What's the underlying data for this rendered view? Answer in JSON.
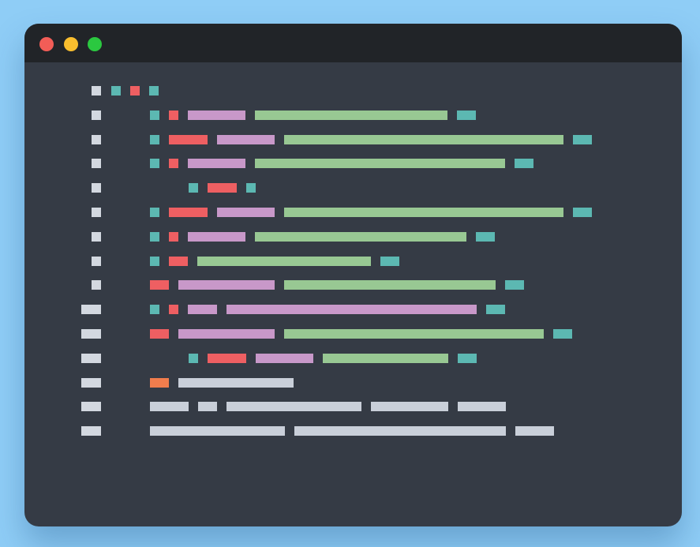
{
  "window": {
    "colors": {
      "background": "#8fcdf6",
      "window": "#353b45",
      "titlebar": "#212428"
    },
    "controls": [
      {
        "name": "close-button",
        "color": "#f25d57"
      },
      {
        "name": "minimize-button",
        "color": "#f9be2e"
      },
      {
        "name": "maximize-button",
        "color": "#2bc840"
      }
    ]
  },
  "code_lines": [
    [
      [
        "g",
        1
      ],
      [
        "t",
        1
      ],
      [
        "r",
        1
      ],
      [
        "t",
        1
      ]
    ],
    [
      [
        "g",
        1
      ],
      [
        "t",
        1
      ],
      [
        "r",
        1
      ],
      [
        "m",
        6
      ],
      [
        "l",
        20
      ],
      [
        "t",
        2
      ]
    ],
    [
      [
        "g",
        1
      ],
      [
        "t",
        1
      ],
      [
        "r",
        4
      ],
      [
        "m",
        6
      ],
      [
        "l",
        29
      ],
      [
        "t",
        2
      ]
    ],
    [
      [
        "g",
        1
      ],
      [
        "t",
        1
      ],
      [
        "r",
        1
      ],
      [
        "m",
        6
      ],
      [
        "l",
        26
      ],
      [
        "t",
        2
      ]
    ],
    [
      [
        "g",
        1
      ],
      [
        "t",
        1
      ],
      [
        "r",
        3
      ],
      [
        "t",
        1
      ]
    ],
    [
      [
        "g",
        1
      ],
      [
        "t",
        1
      ],
      [
        "r",
        4
      ],
      [
        "m",
        6
      ],
      [
        "l",
        29
      ],
      [
        "t",
        2
      ]
    ],
    [
      [
        "g",
        1
      ],
      [
        "t",
        1
      ],
      [
        "r",
        1
      ],
      [
        "m",
        6
      ],
      [
        "l",
        22
      ],
      [
        "t",
        2
      ]
    ],
    [
      [
        "g",
        1
      ],
      [
        "t",
        1
      ],
      [
        "r",
        2
      ],
      [
        "l",
        18
      ],
      [
        "t",
        2
      ]
    ],
    [
      [
        "g",
        1
      ],
      [
        "r",
        2
      ],
      [
        "m",
        10
      ],
      [
        "l",
        22
      ],
      [
        "t",
        2
      ]
    ],
    [
      [
        "g",
        2
      ],
      [
        "t",
        1
      ],
      [
        "r",
        1
      ],
      [
        "m",
        3
      ],
      [
        "m",
        26
      ],
      [
        "t",
        2
      ]
    ],
    [
      [
        "g",
        2
      ],
      [
        "r",
        2
      ],
      [
        "m",
        10
      ],
      [
        "l",
        27
      ],
      [
        "t",
        2
      ]
    ],
    [
      [
        "g",
        2
      ],
      [
        "t",
        1
      ],
      [
        "r",
        4
      ],
      [
        "m",
        6
      ],
      [
        "l",
        13
      ],
      [
        "t",
        2
      ]
    ],
    [
      [
        "g",
        2
      ],
      [
        "o",
        2
      ],
      [
        "w",
        12
      ]
    ],
    [
      [
        "g",
        2
      ],
      [
        "w",
        4
      ],
      [
        "w",
        2
      ],
      [
        "w",
        14
      ],
      [
        "w",
        8
      ],
      [
        "w",
        5
      ]
    ],
    [
      [
        "g",
        2
      ],
      [
        "w",
        14
      ],
      [
        "w",
        22
      ],
      [
        "w",
        4
      ]
    ]
  ],
  "palette": {
    "g": "#d3d8e0",
    "t": "#5cb8b2",
    "r": "#ee5f62",
    "m": "#c898c9",
    "l": "#98c893",
    "o": "#f07d4d",
    "w": "#c9cfd9"
  }
}
